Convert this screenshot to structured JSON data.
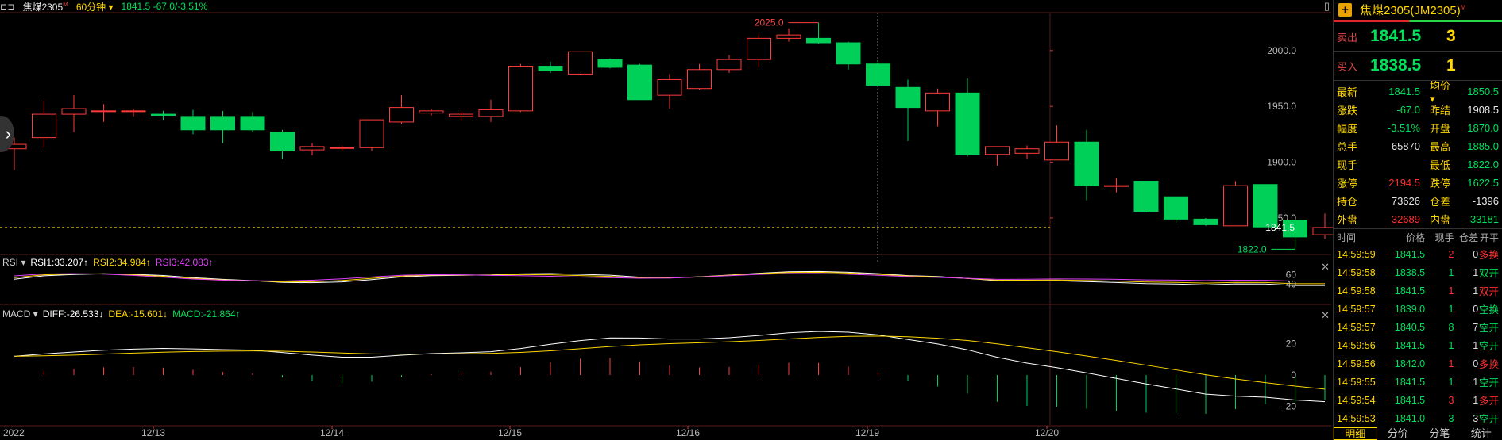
{
  "topbar": {
    "symbol": "焦煤2305",
    "symbol_mark": "M",
    "period": "60分钟 ▾",
    "price_info": "1841.5  -67.0/-3.51%"
  },
  "chart": {
    "ylim": [
      1818,
      2034
    ],
    "y_ticks": [
      "2000.0",
      "1950.0",
      "1900.0",
      "1850.0"
    ],
    "last_price_label": "1841.5",
    "high_marker": "2025.0",
    "low_marker": "1822.0",
    "x_axis_labels": [
      "2022",
      "12/13",
      "12/14",
      "12/15",
      "12/16",
      "12/19",
      "12/20"
    ],
    "candles": [
      [
        1912,
        1922,
        1916,
        1893,
        1920
      ],
      [
        1922,
        1955,
        1943,
        1913,
        1942
      ],
      [
        1943,
        1960,
        1948,
        1927,
        1942
      ],
      [
        1946,
        1952,
        1946,
        1936,
        1946
      ],
      [
        1946,
        1948,
        1946,
        1941,
        1944
      ],
      [
        1943,
        1946,
        1942,
        1938,
        1943
      ],
      [
        1941,
        1947,
        1929,
        1925,
        1935
      ],
      [
        1941,
        1946,
        1929,
        1917,
        1934
      ],
      [
        1941,
        1945,
        1929,
        1927,
        1934
      ],
      [
        1927,
        1929,
        1910,
        1903,
        1918
      ],
      [
        1911,
        1917,
        1914,
        1906,
        1912
      ],
      [
        1913,
        1915,
        1913,
        1910,
        1912
      ],
      [
        1913,
        1938,
        1938,
        1910,
        1926
      ],
      [
        1936,
        1960,
        1949,
        1934,
        1944
      ],
      [
        1944,
        1948,
        1946,
        1942,
        1945
      ],
      [
        1941,
        1945,
        1943,
        1938,
        1942
      ],
      [
        1941,
        1956,
        1947,
        1936,
        1946
      ],
      [
        1946,
        1988,
        1986,
        1945,
        1968
      ],
      [
        1986,
        1990,
        1982,
        1980,
        1984
      ],
      [
        1979,
        1998,
        1999,
        1978,
        1989
      ],
      [
        1992,
        1993,
        1985,
        1984,
        1989
      ],
      [
        1987,
        1988,
        1956,
        1957,
        1972
      ],
      [
        1960,
        1979,
        1974,
        1948,
        1966
      ],
      [
        1966,
        1988,
        1983,
        1965,
        1975
      ],
      [
        1983,
        1996,
        1992,
        1980,
        1988
      ],
      [
        1992,
        2015,
        2011,
        1985,
        2002
      ],
      [
        2011,
        2020,
        2014,
        2008,
        2012
      ],
      [
        2011,
        2025,
        2007,
        2006,
        2009
      ],
      [
        2007,
        2008,
        1988,
        1983,
        1995
      ],
      [
        1988,
        1991,
        1969,
        1968,
        1979
      ],
      [
        1967,
        1974,
        1949,
        1919,
        1959
      ],
      [
        1946,
        1966,
        1962,
        1932,
        1954
      ],
      [
        1962,
        1975,
        1907,
        1905,
        1935
      ],
      [
        1907,
        1914,
        1914,
        1897,
        1910
      ],
      [
        1908,
        1915,
        1912,
        1903,
        1910
      ],
      [
        1902,
        1933,
        1918,
        1902,
        1910
      ],
      [
        1918,
        1929,
        1879,
        1866,
        1896
      ],
      [
        1879,
        1886,
        1879,
        1873,
        1880
      ],
      [
        1883,
        1883,
        1856,
        1855,
        1868
      ],
      [
        1869,
        1869,
        1849,
        1846,
        1860
      ],
      [
        1849,
        1850,
        1844,
        1843,
        1846
      ],
      [
        1843,
        1883,
        1879,
        1843,
        1861
      ],
      [
        1880,
        1880,
        1842,
        1842,
        1861
      ],
      [
        1848,
        1848,
        1833,
        1822,
        1841
      ],
      [
        1835,
        1854,
        1841.5,
        1831,
        1841
      ]
    ],
    "rsi": {
      "label": "RSI ▾",
      "rsi1": "RSI1:33.207↑",
      "rsi2": "RSI2:34.984↑",
      "rsi3": "RSI3:42.083↑",
      "ticks": [
        "60",
        "40"
      ]
    },
    "macd": {
      "label": "MACD ▾",
      "diff": "DIFF:-26.533↓",
      "dea": "DEA:-15.601↓",
      "macd": "MACD:-21.864↑",
      "ticks": [
        "20",
        "0",
        "-20"
      ]
    },
    "colors": {
      "up": "#ff3b3b",
      "down": "#00d058",
      "yellow": "#ffd700",
      "magenta": "#e040fb"
    }
  },
  "panel": {
    "title": "焦煤2305(JM2305)",
    "title_mark": "M",
    "sell_label": "卖出",
    "sell_price": "1841.5",
    "sell_vol": "3",
    "buy_label": "买入",
    "buy_price": "1838.5",
    "buy_vol": "1",
    "stats": [
      {
        "l": "最新",
        "v": "1841.5",
        "vc": "green",
        "l2": "均价 ▾",
        "v2": "1850.5",
        "v2c": "green"
      },
      {
        "l": "涨跌",
        "v": "-67.0",
        "vc": "green",
        "l2": "昨结",
        "v2": "1908.5",
        "v2c": "white"
      },
      {
        "l": "幅度",
        "v": "-3.51%",
        "vc": "green",
        "l2": "开盘",
        "v2": "1870.0",
        "v2c": "green"
      },
      {
        "l": "总手",
        "v": "65870",
        "vc": "white",
        "l2": "最高",
        "v2": "1885.0",
        "v2c": "green"
      },
      {
        "l": "现手",
        "v": "",
        "vc": "white",
        "l2": "最低",
        "v2": "1822.0",
        "v2c": "green"
      },
      {
        "l": "涨停",
        "v": "2194.5",
        "vc": "red",
        "l2": "跌停",
        "v2": "1622.5",
        "v2c": "green"
      },
      {
        "l": "持仓",
        "v": "73626",
        "vc": "white",
        "l2": "仓差",
        "v2": "-1396",
        "v2c": "white"
      },
      {
        "l": "外盘",
        "v": "32689",
        "vc": "red",
        "l2": "内盘",
        "v2": "33181",
        "v2c": "green"
      }
    ],
    "ticks_header": {
      "time": "时间",
      "price": "价格",
      "qty": "现手",
      "oi": "仓差",
      "type": "开平"
    },
    "ticks": [
      {
        "time": "14:59:59",
        "price": "1841.5",
        "qty": "2",
        "qc": "red",
        "oi": "0",
        "type": "多换",
        "tc": "red"
      },
      {
        "time": "14:59:58",
        "price": "1838.5",
        "qty": "1",
        "qc": "green",
        "oi": "1",
        "type": "双开",
        "tc": "green"
      },
      {
        "time": "14:59:58",
        "price": "1841.5",
        "qty": "1",
        "qc": "red",
        "oi": "1",
        "type": "双开",
        "tc": "red"
      },
      {
        "time": "14:59:57",
        "price": "1839.0",
        "qty": "1",
        "qc": "green",
        "oi": "0",
        "type": "空换",
        "tc": "green"
      },
      {
        "time": "14:59:57",
        "price": "1840.5",
        "qty": "8",
        "qc": "green",
        "oi": "7",
        "type": "空开",
        "tc": "green"
      },
      {
        "time": "14:59:56",
        "price": "1841.5",
        "qty": "1",
        "qc": "green",
        "oi": "1",
        "type": "空开",
        "tc": "green"
      },
      {
        "time": "14:59:56",
        "price": "1842.0",
        "qty": "1",
        "qc": "red",
        "oi": "0",
        "type": "多换",
        "tc": "red"
      },
      {
        "time": "14:59:55",
        "price": "1841.5",
        "qty": "1",
        "qc": "green",
        "oi": "1",
        "type": "空开",
        "tc": "green"
      },
      {
        "time": "14:59:54",
        "price": "1841.5",
        "qty": "3",
        "qc": "red",
        "oi": "1",
        "type": "多开",
        "tc": "red"
      },
      {
        "time": "14:59:53",
        "price": "1841.0",
        "qty": "3",
        "qc": "green",
        "oi": "3",
        "type": "空开",
        "tc": "green"
      }
    ],
    "tabs": [
      "明细",
      "分价",
      "分笔",
      "统计"
    ]
  }
}
